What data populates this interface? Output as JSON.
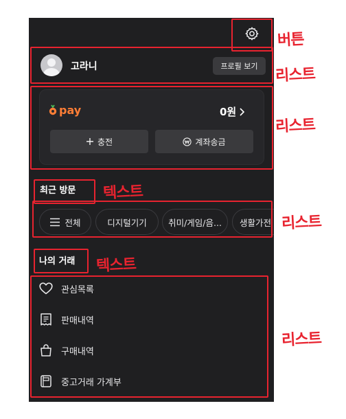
{
  "header": {
    "settings_icon": "gear-icon"
  },
  "profile": {
    "nickname": "고라니",
    "profile_button": "프로필 보기",
    "avatar_icon": "user-avatar-icon"
  },
  "pay": {
    "brand_mark": "carrot-pay-logo",
    "brand_text": "pay",
    "balance": "0원",
    "charge_label": "충전",
    "transfer_label": "계좌송금",
    "accent_color": "#ff7e36"
  },
  "recent": {
    "title": "최근 방문",
    "chips": [
      "전체",
      "디지털기기",
      "취미/게임/음...",
      "생활가전"
    ]
  },
  "trades": {
    "title": "나의 거래",
    "items": [
      {
        "label": "관심목록",
        "icon": "heart-icon"
      },
      {
        "label": "판매내역",
        "icon": "receipt-icon"
      },
      {
        "label": "구매내역",
        "icon": "shopping-bag-icon"
      },
      {
        "label": "중고거래 가계부",
        "icon": "ledger-book-icon"
      }
    ]
  },
  "annotations": {
    "button": "버튼",
    "list": "리스트",
    "text": "텍스트",
    "color": "#e8232f"
  }
}
